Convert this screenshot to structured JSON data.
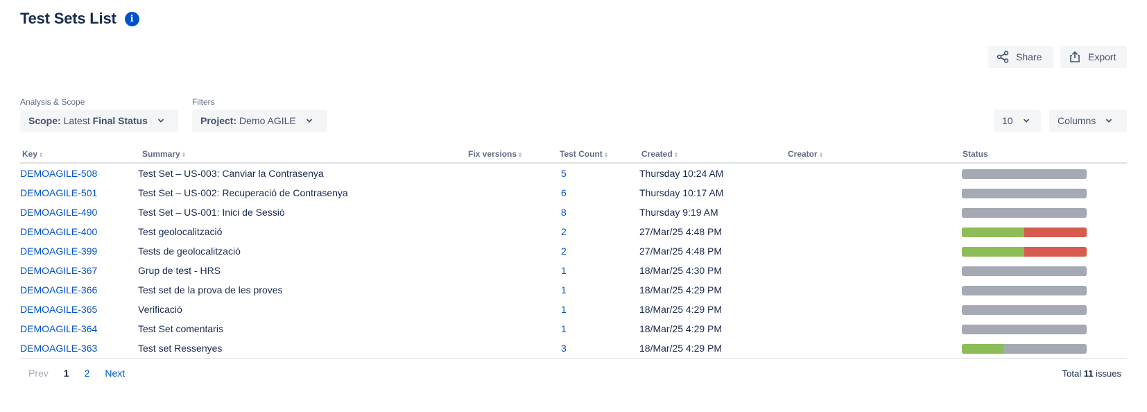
{
  "page": {
    "title": "Test Sets List",
    "info_icon": "i"
  },
  "actions": {
    "share_label": "Share",
    "export_label": "Export"
  },
  "analysis": {
    "label": "Analysis & Scope",
    "scope_key": "Scope:",
    "scope_value_prefix": "Latest",
    "scope_value_bold": "Final Status"
  },
  "filters": {
    "label": "Filters",
    "project_key": "Project:",
    "project_value": "Demo AGILE"
  },
  "page_size": "10",
  "columns_label": "Columns",
  "table": {
    "headers": {
      "key": "Key",
      "summary": "Summary",
      "fix_versions": "Fix versions",
      "test_count": "Test Count",
      "created": "Created",
      "creator": "Creator",
      "status": "Status"
    },
    "rows": [
      {
        "key": "DEMOAGILE-508",
        "summary": "Test Set – US-003: Canviar la Contrasenya",
        "fix_versions": "",
        "test_count": "5",
        "created": "Thursday 10:24 AM",
        "creator": "",
        "status": {
          "pass": 0,
          "fail": 0
        }
      },
      {
        "key": "DEMOAGILE-501",
        "summary": "Test Set – US-002: Recuperació de Contrasenya",
        "fix_versions": "",
        "test_count": "6",
        "created": "Thursday 10:17 AM",
        "creator": "",
        "status": {
          "pass": 0,
          "fail": 0
        }
      },
      {
        "key": "DEMOAGILE-490",
        "summary": "Test Set – US-001: Inici de Sessió",
        "fix_versions": "",
        "test_count": "8",
        "created": "Thursday 9:19 AM",
        "creator": "",
        "status": {
          "pass": 0,
          "fail": 0
        }
      },
      {
        "key": "DEMOAGILE-400",
        "summary": "Test geolocalització",
        "fix_versions": "",
        "test_count": "2",
        "created": "27/Mar/25 4:48 PM",
        "creator": "",
        "status": {
          "pass": 0.5,
          "fail": 0.5
        }
      },
      {
        "key": "DEMOAGILE-399",
        "summary": "Tests de geolocalització",
        "fix_versions": "",
        "test_count": "2",
        "created": "27/Mar/25 4:48 PM",
        "creator": "",
        "status": {
          "pass": 0.5,
          "fail": 0.5
        }
      },
      {
        "key": "DEMOAGILE-367",
        "summary": "Grup de test - HRS",
        "fix_versions": "",
        "test_count": "1",
        "created": "18/Mar/25 4:30 PM",
        "creator": "",
        "status": {
          "pass": 0,
          "fail": 0
        }
      },
      {
        "key": "DEMOAGILE-366",
        "summary": "Test set de la prova de les proves",
        "fix_versions": "",
        "test_count": "1",
        "created": "18/Mar/25 4:29 PM",
        "creator": "",
        "status": {
          "pass": 0,
          "fail": 0
        }
      },
      {
        "key": "DEMOAGILE-365",
        "summary": "Verificació",
        "fix_versions": "",
        "test_count": "1",
        "created": "18/Mar/25 4:29 PM",
        "creator": "",
        "status": {
          "pass": 0,
          "fail": 0
        }
      },
      {
        "key": "DEMOAGILE-364",
        "summary": "Test Set comentaris",
        "fix_versions": "",
        "test_count": "1",
        "created": "18/Mar/25 4:29 PM",
        "creator": "",
        "status": {
          "pass": 0,
          "fail": 0
        }
      },
      {
        "key": "DEMOAGILE-363",
        "summary": "Test set Ressenyes",
        "fix_versions": "",
        "test_count": "3",
        "created": "18/Mar/25 4:29 PM",
        "creator": "",
        "status": {
          "pass": 0.333,
          "fail": 0
        }
      }
    ]
  },
  "status_colors": {
    "pass": "#8dbd56",
    "fail": "#d65c4f",
    "todo": "#a5a9b3"
  },
  "pagination": {
    "prev": "Prev",
    "pages": [
      "1",
      "2"
    ],
    "current": "1",
    "next": "Next"
  },
  "total": {
    "prefix": "Total",
    "count": "11",
    "suffix": "issues"
  }
}
